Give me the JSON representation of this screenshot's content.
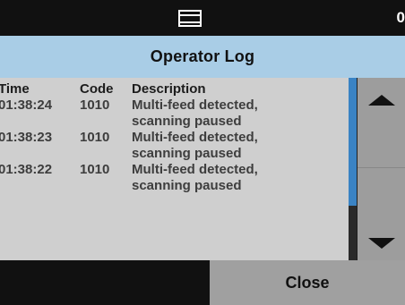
{
  "status_bar": {
    "tray_icon": "output-tray-icon",
    "counter": "0"
  },
  "header": {
    "title": "Operator Log"
  },
  "log": {
    "columns": {
      "time": "Time",
      "code": "Code",
      "description": "Description"
    },
    "entries": [
      {
        "time": "01:38:24",
        "code": "1010",
        "description_line1": "Multi-feed detected,",
        "description_line2": "scanning paused"
      },
      {
        "time": "01:38:23",
        "code": "1010",
        "description_line1": "Multi-feed detected,",
        "description_line2": "scanning paused"
      },
      {
        "time": "01:38:22",
        "code": "1010",
        "description_line1": "Multi-feed detected,",
        "description_line2": "scanning paused"
      }
    ]
  },
  "scroll": {
    "up_icon": "scroll-up-arrow-icon",
    "down_icon": "scroll-down-arrow-icon"
  },
  "footer": {
    "close_label": "Close"
  },
  "colors": {
    "title_bar": "#a9cde6",
    "panel": "#cfcfcf",
    "scroll_thumb": "#3a83c4",
    "buttons": "#a0a0a0"
  }
}
